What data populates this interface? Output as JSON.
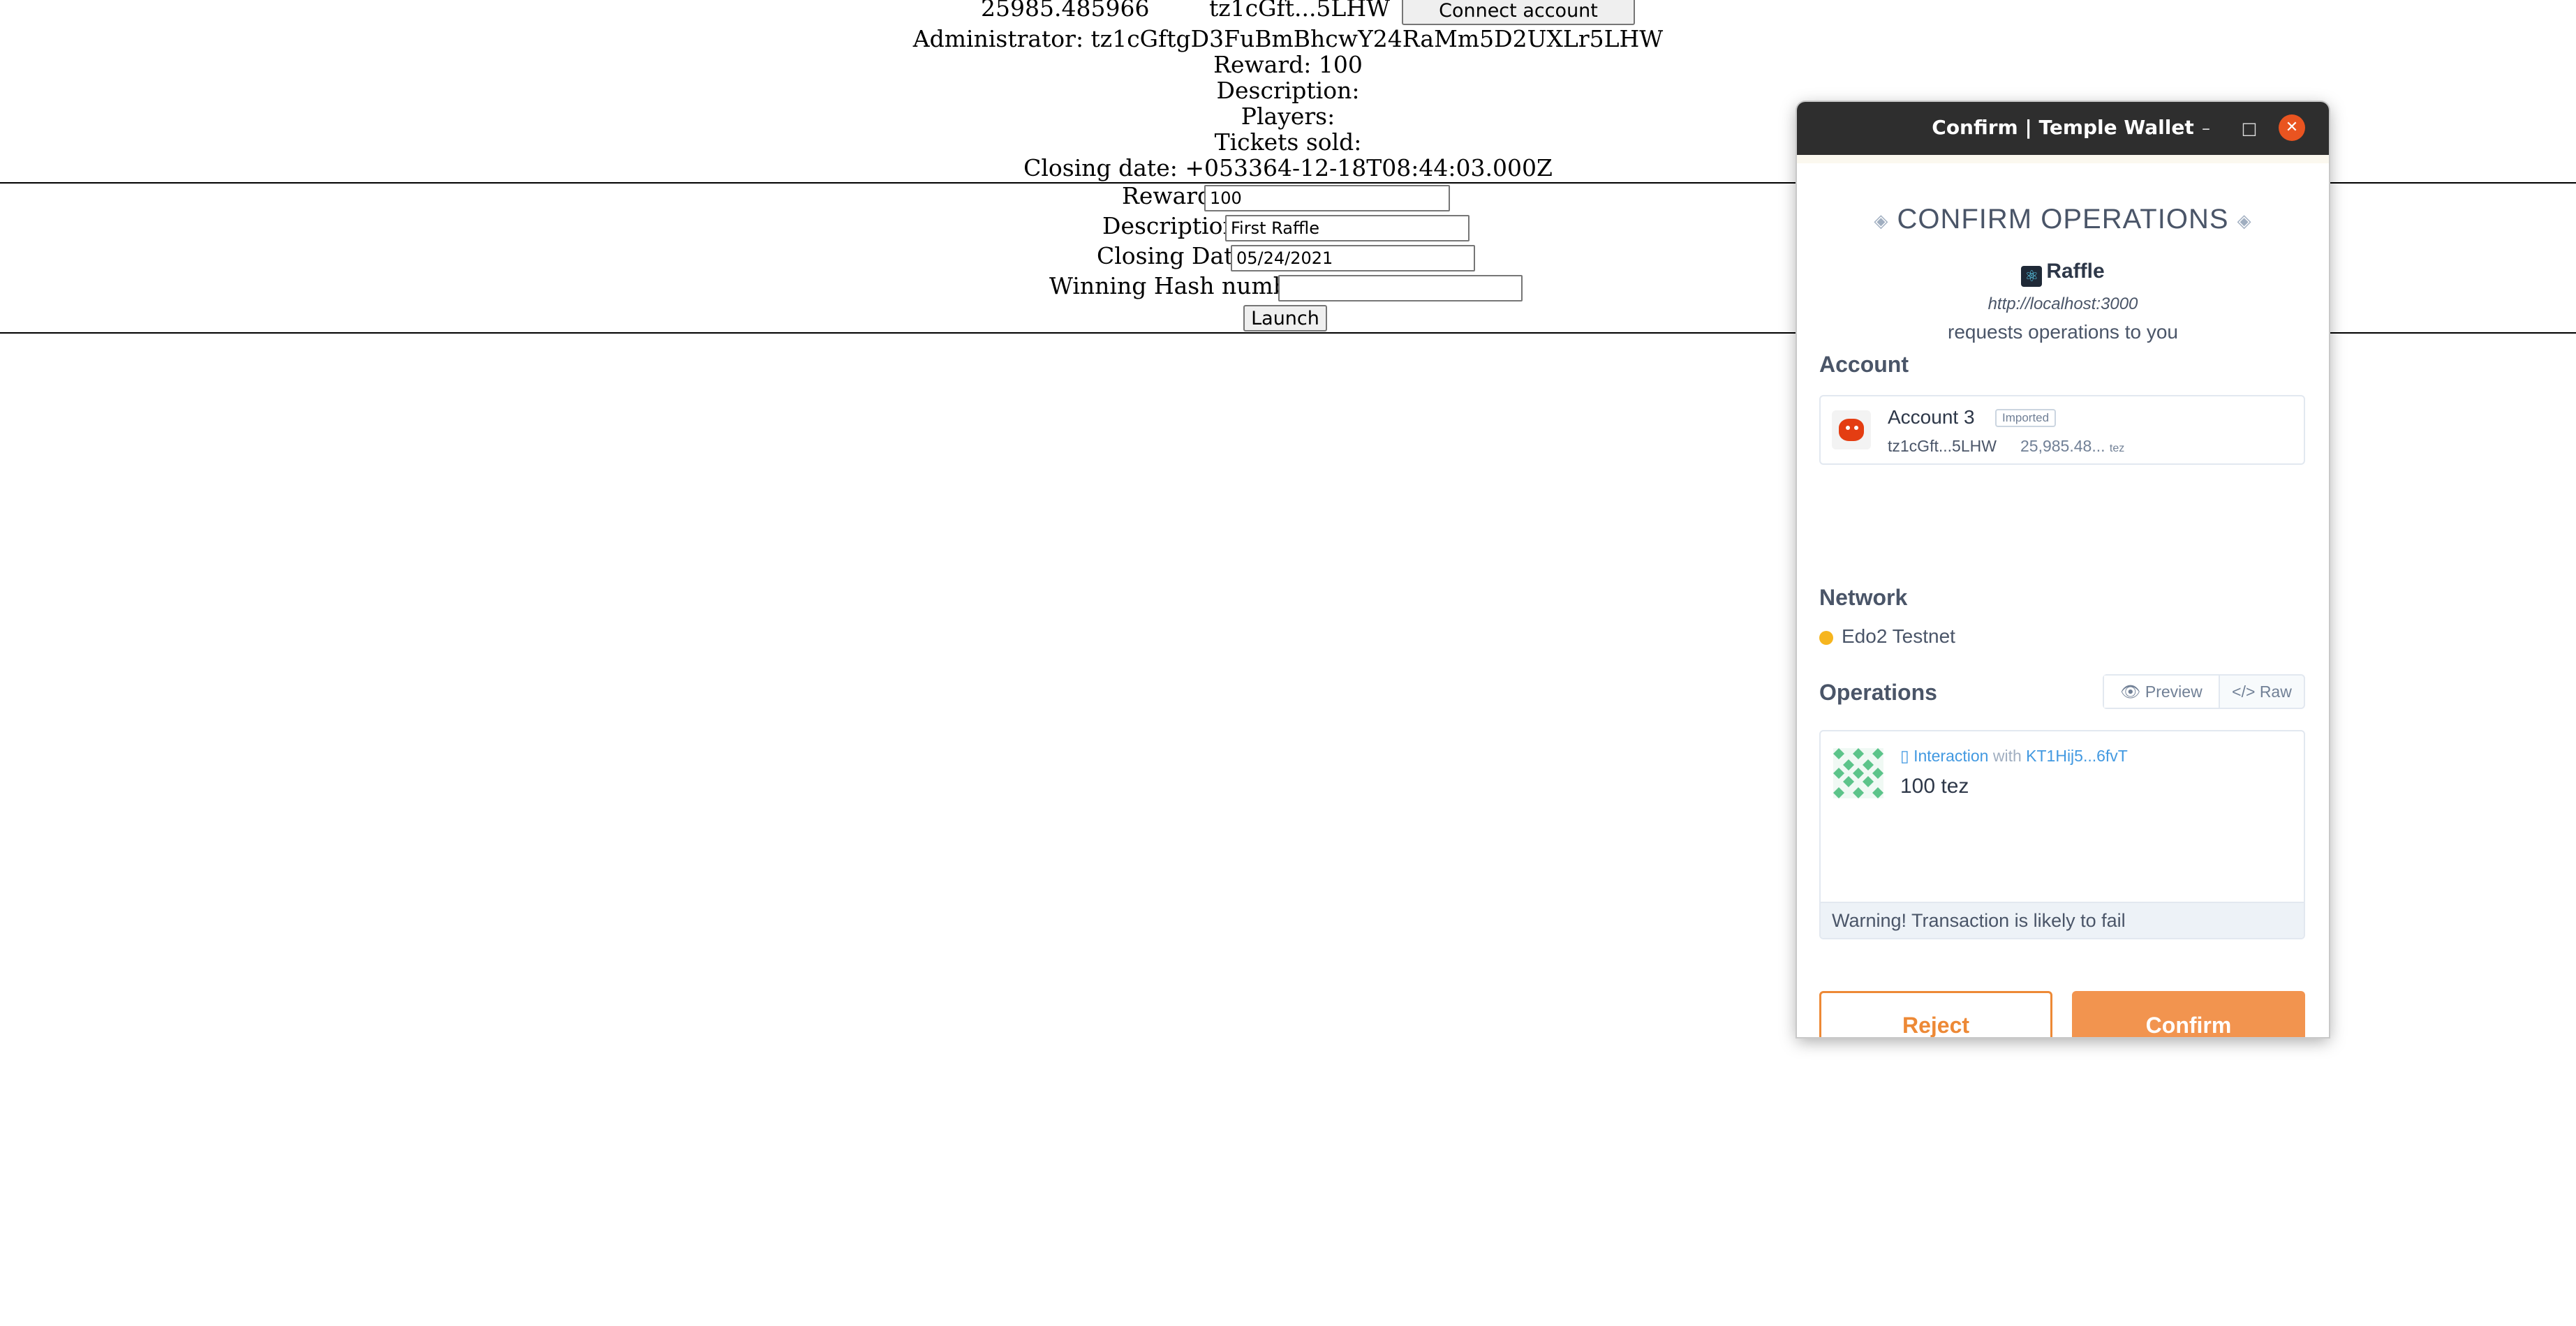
{
  "dapp": {
    "balance": "25985.485966",
    "address_short": "tz1cGft...5LHW",
    "connect_label": "Connect account",
    "administrator": "Administrator: tz1cGftgD3FuBmBhcwY24RaMm5D2UXLr5LHW",
    "reward": "Reward: 100",
    "description": "Description:",
    "players": "Players:",
    "tickets_sold": "Tickets sold:",
    "closing_date": "Closing date: +053364-12-18T08:44:03.000Z",
    "form": {
      "reward_label": "Reward:",
      "reward_value": "100",
      "description_label": "Description:",
      "description_value": "First Raffle",
      "closing_label": "Closing Date:",
      "closing_value": "05/24/2021",
      "hash_label": "Winning Hash number:",
      "hash_value": "",
      "launch_label": "Launch"
    }
  },
  "wallet": {
    "window_title": "Confirm | Temple Wallet",
    "minimize_symbol": "–",
    "maximize_symbol": "□",
    "close_symbol": "✕",
    "heading": "CONFIRM OPERATIONS",
    "app_name": "Raffle",
    "origin": "http://localhost:3000",
    "requests_text": "requests operations to you",
    "account_section": "Account",
    "account": {
      "name": "Account 3",
      "badge": "Imported",
      "address": "tz1cGft...5LHW",
      "balance": "25,985.48...",
      "unit": "tez"
    },
    "network_section": "Network",
    "network_name": "Edo2 Testnet",
    "network_color": "#f6b51e",
    "operations_section": "Operations",
    "view_preview": "Preview",
    "view_raw": "Raw",
    "operation": {
      "type": "Interaction",
      "with_word": "with",
      "contract": "KT1Hij5...6fvT",
      "amount": "100 tez"
    },
    "warning": "Warning! Transaction is likely to fail",
    "reject_label": "Reject",
    "confirm_label": "Confirm",
    "accent_color": "#f2944f"
  }
}
